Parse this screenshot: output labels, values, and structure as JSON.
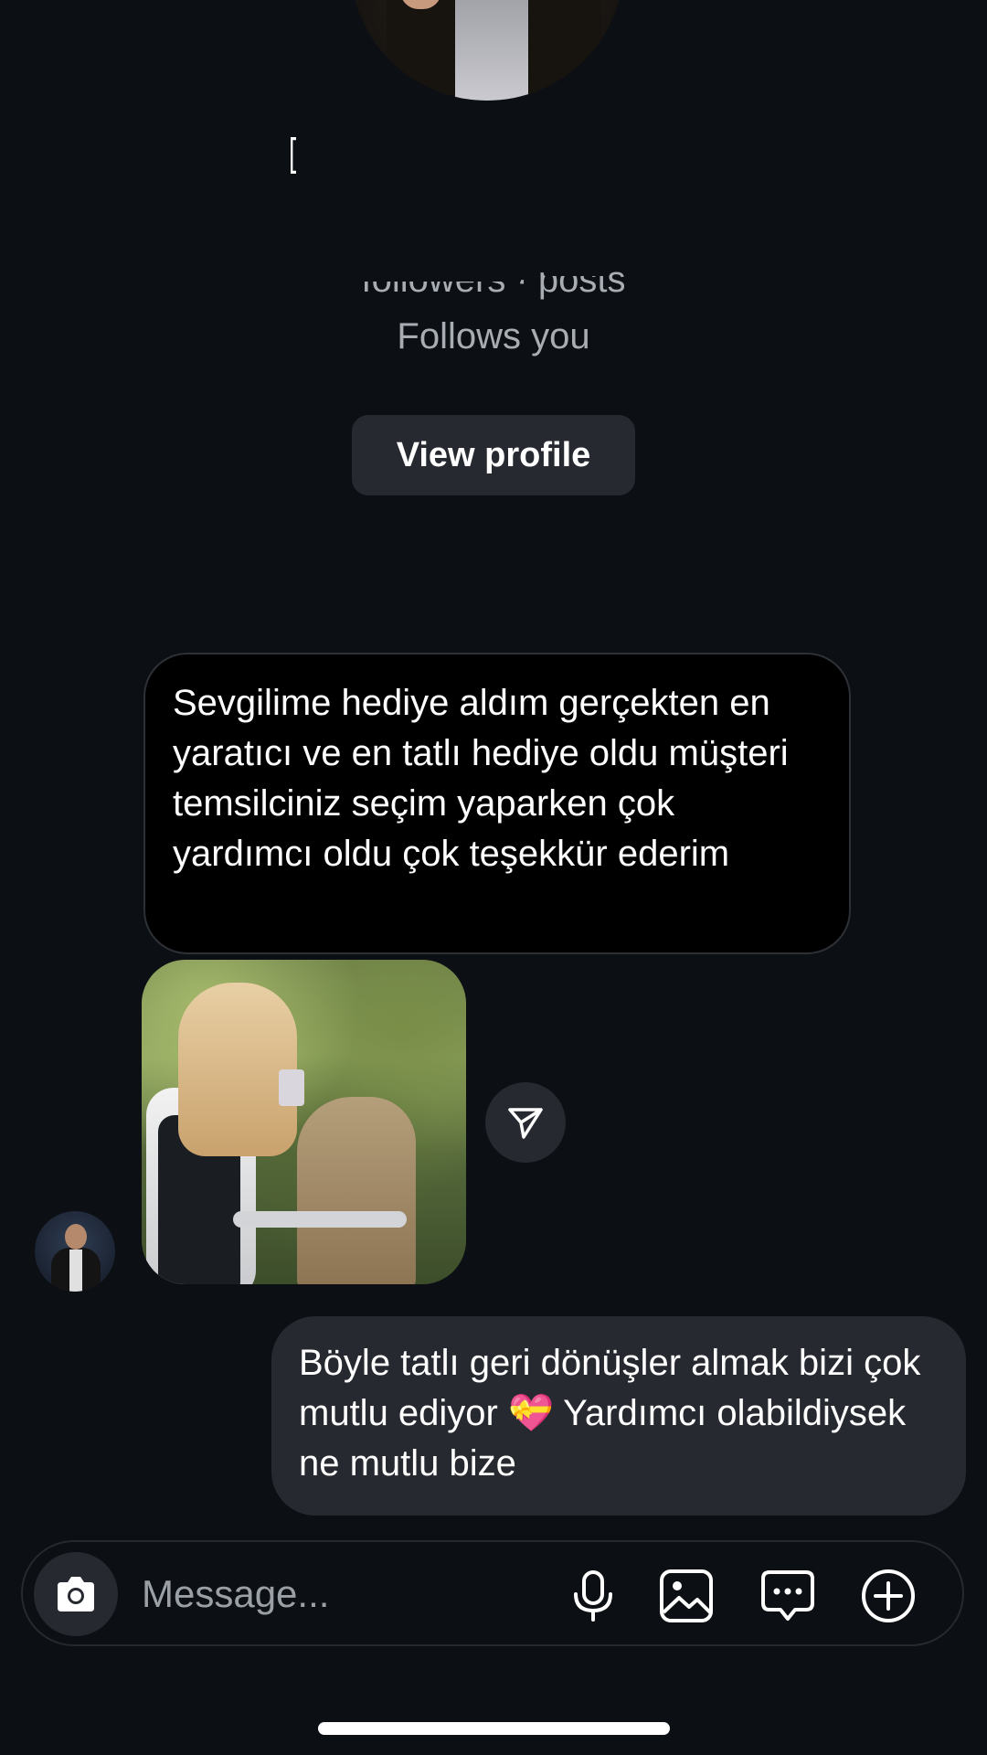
{
  "profile": {
    "stats_text": "followers · posts",
    "follows_you": "Follows you",
    "view_profile_label": "View profile"
  },
  "messages": [
    {
      "direction": "received",
      "text": "Sevgilime hediye aldım gerçekten en yaratıcı ve en tatlı hediye oldu müşteri temsilciniz seçim yaparken çok yardımcı oldu çok teşekkür ederim"
    },
    {
      "direction": "sent",
      "text": "Böyle tatlı geri dönüşler almak bizi çok mutlu ediyor 💝 Yardımcı olabildiysek ne mutlu bize"
    }
  ],
  "composer": {
    "placeholder": "Message..."
  },
  "icons": {
    "camera": "camera-icon",
    "share": "paper-plane-icon",
    "microphone": "microphone-icon",
    "gallery": "image-icon",
    "sticker": "chat-bubble-icon",
    "add": "plus-circle-icon"
  },
  "colors": {
    "background": "#0c1014",
    "sent_bubble": "#262a30",
    "received_bubble": "#000000",
    "secondary_text": "#a8adb3"
  }
}
